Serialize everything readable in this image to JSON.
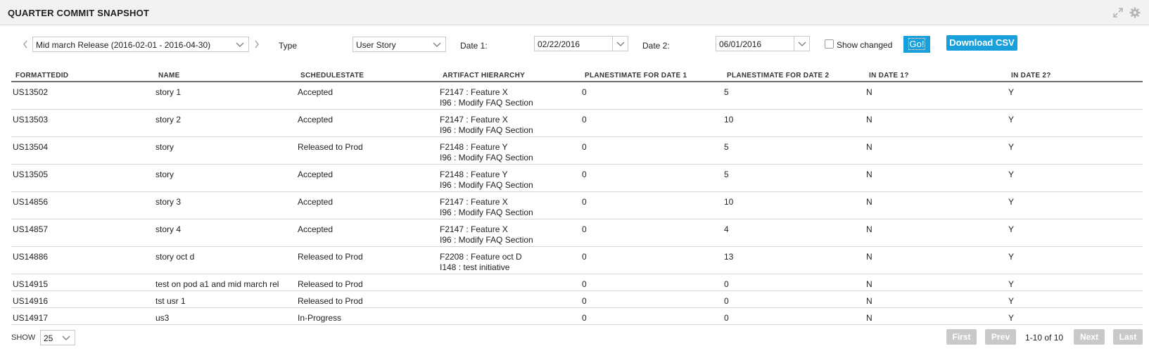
{
  "panel": {
    "title": "QUARTER COMMIT SNAPSHOT",
    "icons": [
      "expand-icon",
      "gear-icon"
    ]
  },
  "controls": {
    "release": {
      "value": "Mid march Release (2016-02-01 - 2016-04-30)"
    },
    "type_label": "Type",
    "type": {
      "value": "User Story"
    },
    "date1_label": "Date 1:",
    "date1": {
      "value": "02/22/2016"
    },
    "date2_label": "Date 2:",
    "date2": {
      "value": "06/01/2016"
    },
    "show_changed_label": "Show changed",
    "show_changed_checked": false,
    "go_label": "Go!",
    "download_label": "Download CSV"
  },
  "grid": {
    "columns": [
      "FORMATTEDID",
      "NAME",
      "SCHEDULESTATE",
      "ARTIFACT HIERARCHY",
      "PLANESTIMATE FOR DATE 1",
      "PLANESTIMATE FOR DATE 2",
      "IN DATE 1?",
      "IN DATE 2?"
    ],
    "rows": [
      {
        "id": "US13502",
        "name": "story 1",
        "state": "Accepted",
        "hier1": "F2147 : Feature X",
        "hier2": "I96 : Modify FAQ Section",
        "pe1": "0",
        "pe2": "5",
        "in1": "N",
        "in2": "Y"
      },
      {
        "id": "US13503",
        "name": "story 2",
        "state": "Accepted",
        "hier1": "F2147 : Feature X",
        "hier2": "I96 : Modify FAQ Section",
        "pe1": "0",
        "pe2": "10",
        "in1": "N",
        "in2": "Y"
      },
      {
        "id": "US13504",
        "name": "story",
        "state": "Released to Prod",
        "hier1": "F2148 : Feature Y",
        "hier2": "I96 : Modify FAQ Section",
        "pe1": "0",
        "pe2": "5",
        "in1": "N",
        "in2": "Y"
      },
      {
        "id": "US13505",
        "name": "story",
        "state": "Accepted",
        "hier1": "F2148 : Feature Y",
        "hier2": "I96 : Modify FAQ Section",
        "pe1": "0",
        "pe2": "5",
        "in1": "N",
        "in2": "Y"
      },
      {
        "id": "US14856",
        "name": "story 3",
        "state": "Accepted",
        "hier1": "F2147 : Feature X",
        "hier2": "I96 : Modify FAQ Section",
        "pe1": "0",
        "pe2": "10",
        "in1": "N",
        "in2": "Y"
      },
      {
        "id": "US14857",
        "name": "story 4",
        "state": "Accepted",
        "hier1": "F2147 : Feature X",
        "hier2": "I96 : Modify FAQ Section",
        "pe1": "0",
        "pe2": "4",
        "in1": "N",
        "in2": "Y"
      },
      {
        "id": "US14886",
        "name": "story oct d",
        "state": "Released to Prod",
        "hier1": "F2208 : Feature oct D",
        "hier2": "I148 : test initiative",
        "pe1": "0",
        "pe2": "13",
        "in1": "N",
        "in2": "Y"
      },
      {
        "id": "US14915",
        "name": "test on pod a1 and mid march rel",
        "state": "Released to Prod",
        "hier1": "",
        "hier2": "",
        "pe1": "0",
        "pe2": "0",
        "in1": "N",
        "in2": "Y"
      },
      {
        "id": "US14916",
        "name": "tst usr 1",
        "state": "Released to Prod",
        "hier1": "",
        "hier2": "",
        "pe1": "0",
        "pe2": "0",
        "in1": "N",
        "in2": "Y"
      },
      {
        "id": "US14917",
        "name": "us3",
        "state": "In-Progress",
        "hier1": "",
        "hier2": "",
        "pe1": "0",
        "pe2": "0",
        "in1": "N",
        "in2": "Y"
      }
    ]
  },
  "footer": {
    "show_label": "SHOW",
    "page_size": "25",
    "first_label": "First",
    "prev_label": "Prev",
    "page_info": "1-10 of 10",
    "next_label": "Next",
    "last_label": "Last"
  },
  "colors": {
    "accent": "#17a0db",
    "pager_disabled": "#c9c9c9",
    "titlebar": "#f2f2f2"
  }
}
